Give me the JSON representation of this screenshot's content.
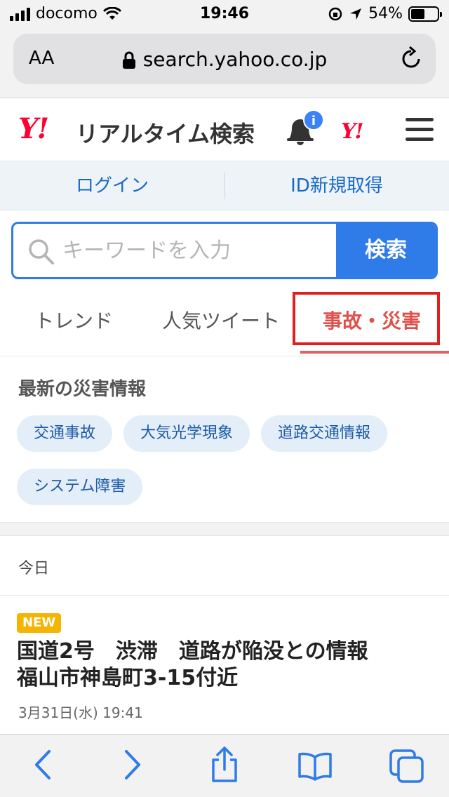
{
  "status_bar": {
    "carrier": "docomo",
    "time": "19:46",
    "battery": "54%"
  },
  "address_bar": {
    "text_size_label": "AA",
    "url": "search.yahoo.co.jp"
  },
  "header": {
    "logo": "Y!",
    "title": "リアルタイム検索",
    "notification_badge": "i",
    "yahoo_small_logo": "Y!"
  },
  "account": {
    "login": "ログイン",
    "register": "ID新規取得"
  },
  "search": {
    "placeholder": "キーワードを入力",
    "button": "検索"
  },
  "tabs": [
    {
      "label": "トレンド",
      "active": false
    },
    {
      "label": "人気ツイート",
      "active": false
    },
    {
      "label": "事故・災害",
      "active": true
    }
  ],
  "disaster": {
    "title": "最新の災害情報",
    "chips": [
      "交通事故",
      "大気光学現象",
      "道路交通情報",
      "システム障害"
    ]
  },
  "feed": {
    "section": "今日",
    "items": [
      {
        "badge": "NEW",
        "headline_line1": "国道2号　渋滞　道路が陥没との情報",
        "headline_line2": "福山市神島町3-15付近",
        "time": "3月31日(水) 19:41"
      }
    ]
  },
  "colors": {
    "accent": "#2f7be8",
    "brand_red": "#ff0033",
    "tab_active": "#e0504a",
    "highlight_box": "#e02020"
  },
  "icons": {
    "toolbar": [
      "back-icon",
      "forward-icon",
      "share-icon",
      "bookmarks-icon",
      "tabs-icon"
    ]
  }
}
